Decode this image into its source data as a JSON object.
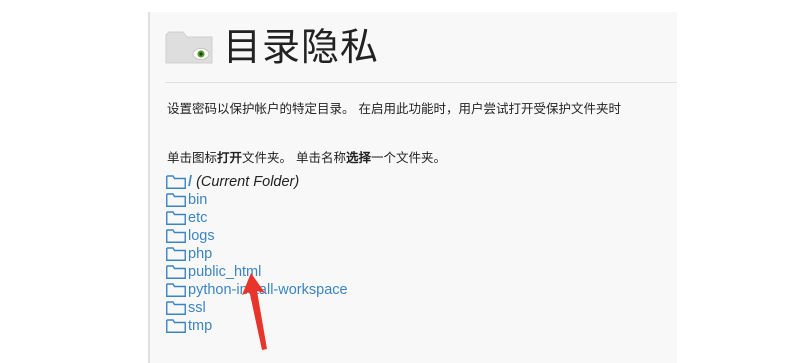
{
  "page": {
    "title": "目录隐私",
    "description": "设置密码以保护帐户的特定目录。 在启用此功能时，用户尝试打开受保护文件夹时",
    "instructions": {
      "part1": "单击图标",
      "open": "打开",
      "part2": "文件夹。 单击名称",
      "select": "选择",
      "part3": "一个文件夹。"
    }
  },
  "folders": {
    "current": {
      "slash": "/",
      "label": "(Current Folder)"
    },
    "items": [
      {
        "name": "bin"
      },
      {
        "name": "etc"
      },
      {
        "name": "logs"
      },
      {
        "name": "php"
      },
      {
        "name": "public_html"
      },
      {
        "name": "python-install-workspace"
      },
      {
        "name": "ssl"
      },
      {
        "name": "tmp"
      }
    ]
  },
  "colors": {
    "link": "#3b84c4",
    "annotation_arrow": "#e8342b",
    "panel_background": "#f8f8f8"
  }
}
